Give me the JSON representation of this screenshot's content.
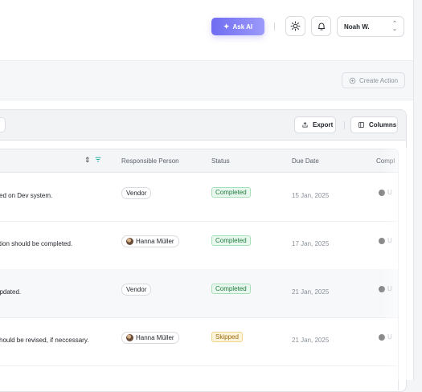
{
  "header": {
    "ask_ai_label": "Ask AI",
    "user_name": "Noah W."
  },
  "subbar": {
    "create_action_label": "Create Action"
  },
  "toolbar": {
    "export_label": "Export",
    "columns_label": "Columns"
  },
  "table": {
    "columns": [
      "Responsible Person",
      "Status",
      "Due Date",
      "Compl"
    ],
    "rows": [
      {
        "description": "xed on Dev system.",
        "person": "Vendor",
        "status": "Completed",
        "due": "15 Jan, 2025",
        "comp": "U"
      },
      {
        "description": "ction should be completed.",
        "person": "Hanna Müller",
        "status": "Completed",
        "due": "17 Jan, 2025",
        "comp": "U"
      },
      {
        "description": "updated.",
        "person": "Vendor",
        "status": "Completed",
        "due": "21 Jan, 2025",
        "comp": "U"
      },
      {
        "description": "should be revised, if neccessary.",
        "person": "Hanna Müller",
        "status": "Skipped",
        "due": "21 Jan, 2025",
        "comp": "U"
      }
    ]
  },
  "colors": {
    "accent": "#7b78f5",
    "completed": "#1e7a3e",
    "skipped": "#9a6b0c"
  }
}
